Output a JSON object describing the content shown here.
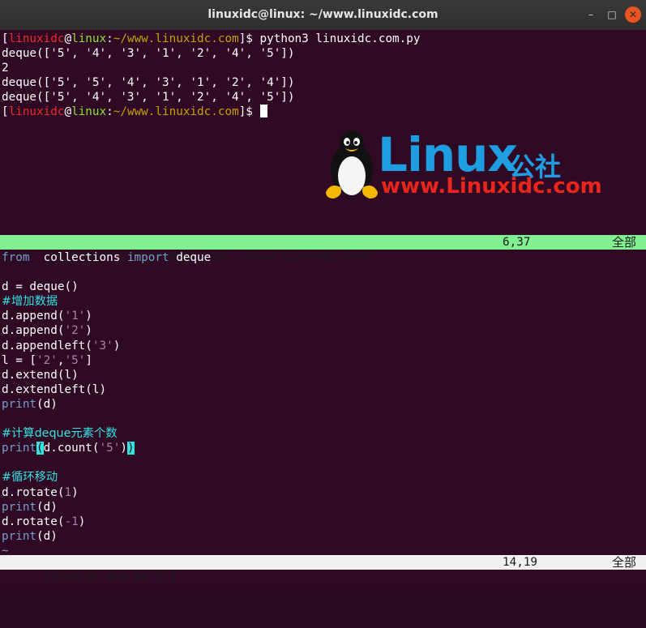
{
  "window": {
    "title": "linuxidc@linux: ~/www.linuxidc.com",
    "minimize_glyph": "–",
    "maximize_glyph": "□",
    "close_glyph": "✕"
  },
  "terminal": {
    "prompt": {
      "open": "[",
      "user": "linuxidc",
      "at": "@",
      "host": "linux",
      "colon": ":",
      "path": "~/www.linuxidc.com",
      "close": "]$ "
    },
    "command": "python3 linuxidc.com.py",
    "output": [
      "deque(['5', '4', '3', '1', '2', '4', '5'])",
      "2",
      "deque(['5', '5', '4', '3', '1', '2', '4'])",
      "deque(['5', '4', '3', '1', '2', '4', '5'])"
    ]
  },
  "watermark": {
    "brand": "Linux",
    "brand_cn": "公社",
    "url": "www.Linuxidc.com"
  },
  "status_top": {
    "label": "!/bin/bash [linuxidc@linux: ~/www.linuxidc.com]",
    "position": "6,37",
    "range": "全部"
  },
  "editor": {
    "kw_from": "from",
    "mod": "  collections ",
    "kw_import": "import",
    "import_name": " deque",
    "l_deque": "d = deque()",
    "c1": "#增加数据",
    "a1_pre": "d.append(",
    "a1_str": "'1'",
    "a1_post": ")",
    "a2_pre": "d.append(",
    "a2_str": "'2'",
    "a2_post": ")",
    "a3_pre": "d.appendleft(",
    "a3_str": "'3'",
    "a3_post": ")",
    "l_pre": "l = [",
    "l_s1": "'2'",
    "l_comma": ",",
    "l_s2": "'5'",
    "l_post": "]",
    "ext": "d.extend(l)",
    "extl": "d.extendleft(l)",
    "kw_print": "print",
    "print_arg": "(d)",
    "c2": "#计算deque元素个数",
    "pc_open": "(",
    "pc_mid": "d.count(",
    "pc_str": "'5'",
    "pc_close1": ")",
    "pc_close2": ")",
    "c3": "#循环移动",
    "r1_pre": "d.rotate(",
    "r1_num": "1",
    "r1_post": ")",
    "r2_pre": "d.rotate(",
    "r2_num": "-1",
    "r2_post": ")",
    "tilde": "~"
  },
  "status_bottom": {
    "file": "linuxidc.com.py [+]",
    "position": "14,19",
    "range": "全部"
  }
}
